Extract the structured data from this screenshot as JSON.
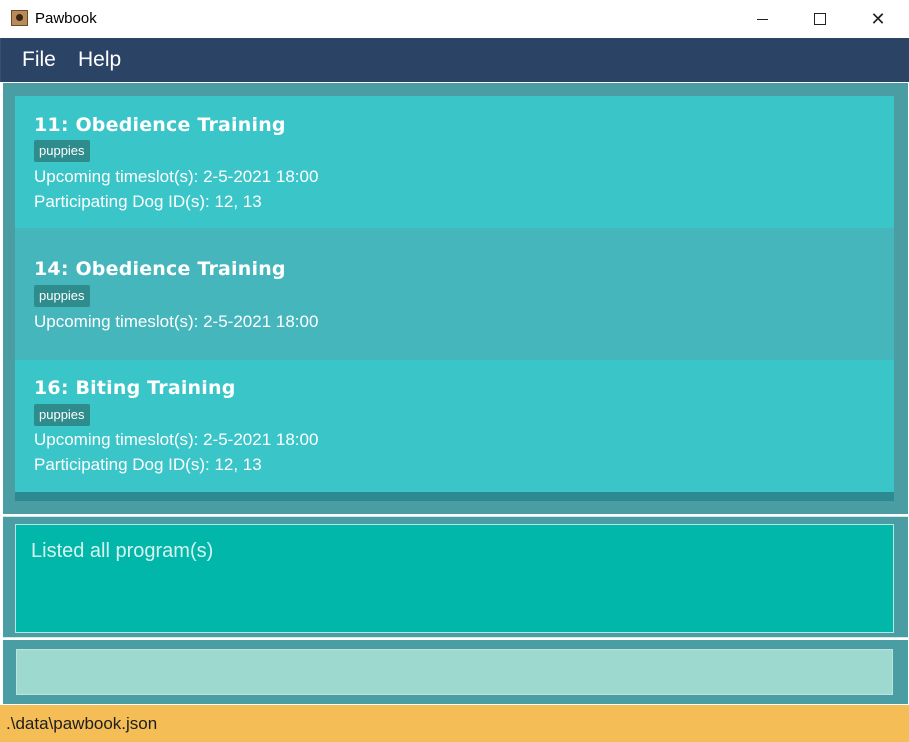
{
  "window": {
    "title": "Pawbook",
    "close_glyph": "✕"
  },
  "menu": {
    "file": "File",
    "help": "Help"
  },
  "programs": [
    {
      "title": "11:  Obedience Training",
      "tag": "puppies",
      "timeslots": "Upcoming timeslot(s): 2-5-2021 18:00",
      "dogs": "Participating Dog ID(s): 12, 13"
    },
    {
      "title": "14:  Obedience Training",
      "tag": "puppies",
      "timeslots": "Upcoming timeslot(s): 2-5-2021 18:00"
    },
    {
      "title": "16:  Biting Training",
      "tag": "puppies",
      "timeslots": "Upcoming timeslot(s): 2-5-2021 18:00",
      "dogs": "Participating Dog ID(s): 12, 13"
    }
  ],
  "result": {
    "message": "Listed all program(s)"
  },
  "command": {
    "value": ""
  },
  "status": {
    "file_path": ".\\data\\pawbook.json"
  },
  "colors": {
    "menubar": "#2b4465",
    "card": "#3ac5c9",
    "card_selected": "#46b6bd",
    "result_box": "#00b7aa",
    "command_box": "#9dd9cf",
    "statusbar": "#f4bd56"
  },
  "icons": {
    "app": "pawbook-app-icon",
    "minimize": "minimize-icon",
    "maximize": "maximize-icon",
    "close": "close-icon"
  }
}
